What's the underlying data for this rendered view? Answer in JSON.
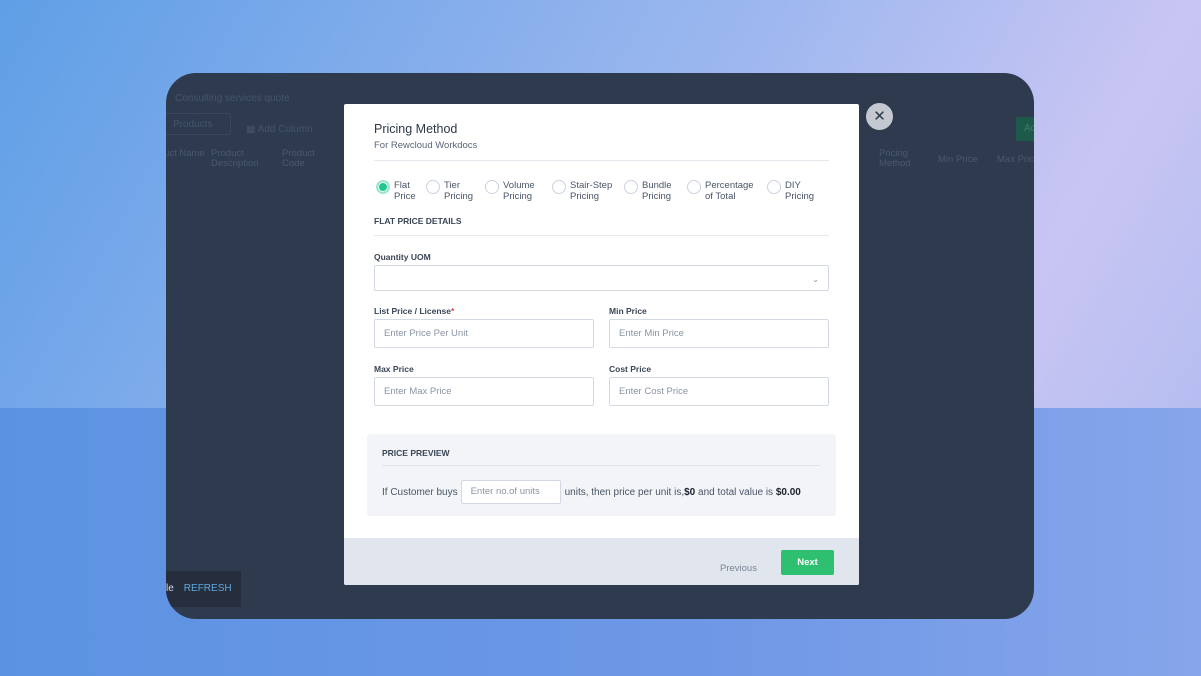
{
  "background": {
    "quote_title": "Consulting services quote",
    "search_placeholder": "Products",
    "add_column": "Add Column",
    "add_button": "Ad",
    "columns": [
      "Product Name",
      "Product Description",
      "Product Code",
      "Pricing Method",
      "Min Price",
      "Max Price"
    ],
    "snackbar_text": "le",
    "snackbar_action": "REFRESH"
  },
  "modal": {
    "title": "Pricing Method",
    "subtitle": "For Rewcloud Workdocs",
    "pricing_options": [
      {
        "label1": "Flat",
        "label2": "Price",
        "selected": true
      },
      {
        "label1": "Tier",
        "label2": "Pricing",
        "selected": false
      },
      {
        "label1": "Volume",
        "label2": "Pricing",
        "selected": false
      },
      {
        "label1": "Stair-Step",
        "label2": "Pricing",
        "selected": false
      },
      {
        "label1": "Bundle",
        "label2": "Pricing",
        "selected": false
      },
      {
        "label1": "Percentage",
        "label2": "of Total",
        "selected": false
      },
      {
        "label1": "DIY",
        "label2": "Pricing",
        "selected": false
      }
    ],
    "section_title": "FLAT PRICE DETAILS",
    "quantity_uom_label": "Quantity UOM",
    "quantity_uom_value": "",
    "list_price_label": "List Price / License",
    "list_price_placeholder": "Enter Price Per Unit",
    "min_price_label": "Min Price",
    "min_price_placeholder": "Enter Min Price",
    "max_price_label": "Max Price",
    "max_price_placeholder": "Enter Max Price",
    "cost_price_label": "Cost Price",
    "cost_price_placeholder": "Enter Cost Price",
    "preview": {
      "title": "PRICE PREVIEW",
      "prefix": "If Customer buys",
      "units_placeholder": "Enter no.of units",
      "middle": "units, then price per unit is,",
      "unit_price": "$0",
      "and_total": " and total value is ",
      "total": "$0.00"
    },
    "previous": "Previous",
    "next": "Next",
    "accent": "#1fc690"
  }
}
